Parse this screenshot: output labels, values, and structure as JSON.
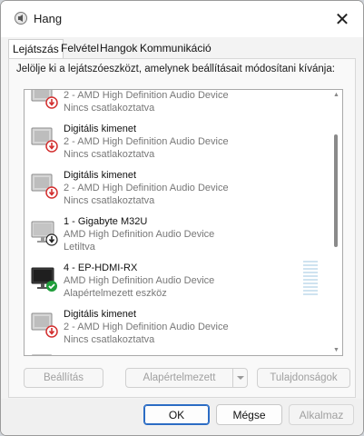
{
  "window": {
    "title": "Hang",
    "close_glyph": "✕"
  },
  "tabs": [
    {
      "label": "Lejátszás",
      "active": true
    },
    {
      "label": "Felvétel",
      "active": false
    },
    {
      "label": "Hangok",
      "active": false
    },
    {
      "label": "Kommunikáció",
      "active": false
    }
  ],
  "instruction": "Jelölje ki a lejátszóeszközt, amelynek beállításait módosítani kívánja:",
  "devices": [
    {
      "name": "",
      "driver": "2 - AMD High Definition Audio Device",
      "status": "Nincs csatlakoztatva",
      "icon": "speaker-disconnected-icon",
      "badge": "red-down-arrow"
    },
    {
      "name": "Digitális kimenet",
      "driver": "2 - AMD High Definition Audio Device",
      "status": "Nincs csatlakoztatva",
      "icon": "speaker-disconnected-icon",
      "badge": "red-down-arrow"
    },
    {
      "name": "Digitális kimenet",
      "driver": "2 - AMD High Definition Audio Device",
      "status": "Nincs csatlakoztatva",
      "icon": "speaker-disconnected-icon",
      "badge": "red-down-arrow"
    },
    {
      "name": "1 - Gigabyte M32U",
      "driver": "AMD High Definition Audio Device",
      "status": "Letiltva",
      "icon": "monitor-disabled-icon",
      "badge": "black-down-arrow"
    },
    {
      "name": "4 - EP-HDMI-RX",
      "driver": "AMD High Definition Audio Device",
      "status": "Alapértelmezett eszköz",
      "icon": "monitor-default-icon",
      "badge": "green-check"
    },
    {
      "name": "Digitális kimenet",
      "driver": "2 - AMD High Definition Audio Device",
      "status": "Nincs csatlakoztatva",
      "icon": "speaker-disconnected-icon",
      "badge": "red-down-arrow"
    }
  ],
  "default_device_level": 0,
  "buttons": {
    "configure": "Beállítás",
    "set_default": "Alapértelmezett",
    "properties": "Tulajdonságok"
  },
  "footer": {
    "ok": "OK",
    "cancel": "Mégse",
    "apply": "Alkalmaz"
  },
  "colors": {
    "accent": "#2b6cc4",
    "status_red": "#d32f2f",
    "status_green": "#1f9d3a"
  }
}
